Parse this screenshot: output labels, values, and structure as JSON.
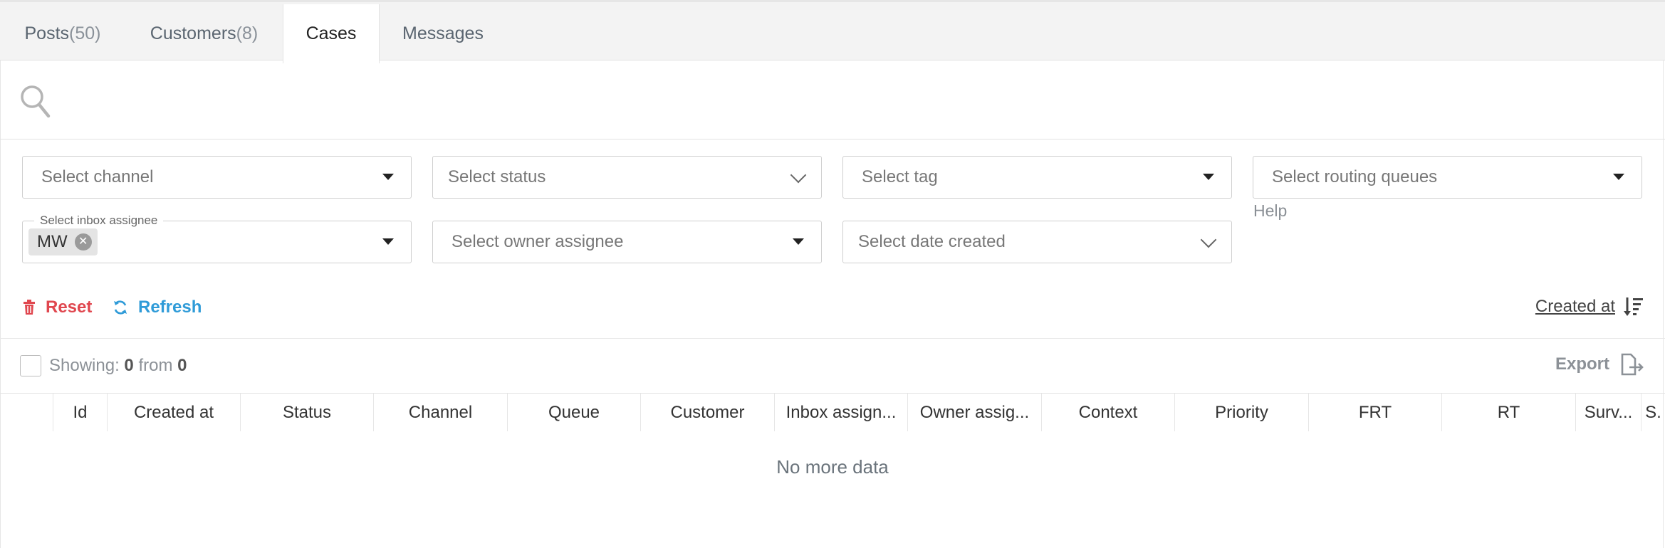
{
  "tabs": [
    {
      "label": "Posts",
      "count": "(50)"
    },
    {
      "label": "Customers",
      "count": "(8)"
    },
    {
      "label": "Cases",
      "count": ""
    },
    {
      "label": "Messages",
      "count": ""
    }
  ],
  "filters": {
    "channel": "Select channel",
    "status": "Select status",
    "tag": "Select tag",
    "routing_queues": "Select routing queues",
    "inbox_assignee_legend": "Select inbox assignee",
    "inbox_assignee_chip": "MW",
    "owner_assignee": "Select owner assignee",
    "date_created": "Select date created",
    "help": "Help"
  },
  "actions": {
    "reset": "Reset",
    "refresh": "Refresh",
    "sort_label": "Created at"
  },
  "summary": {
    "showing_label": "Showing:",
    "shown": "0",
    "from_label": "from",
    "total": "0",
    "export": "Export"
  },
  "table": {
    "columns": [
      "Id",
      "Created at",
      "Status",
      "Channel",
      "Queue",
      "Customer",
      "Inbox assign...",
      "Owner assig...",
      "Context",
      "Priority",
      "FRT",
      "RT",
      "Surv...",
      "S."
    ],
    "empty_text": "No more data"
  },
  "colors": {
    "reset": "#e0474f",
    "refresh": "#2f9bd8",
    "tabbar": "#f3f3f3"
  }
}
